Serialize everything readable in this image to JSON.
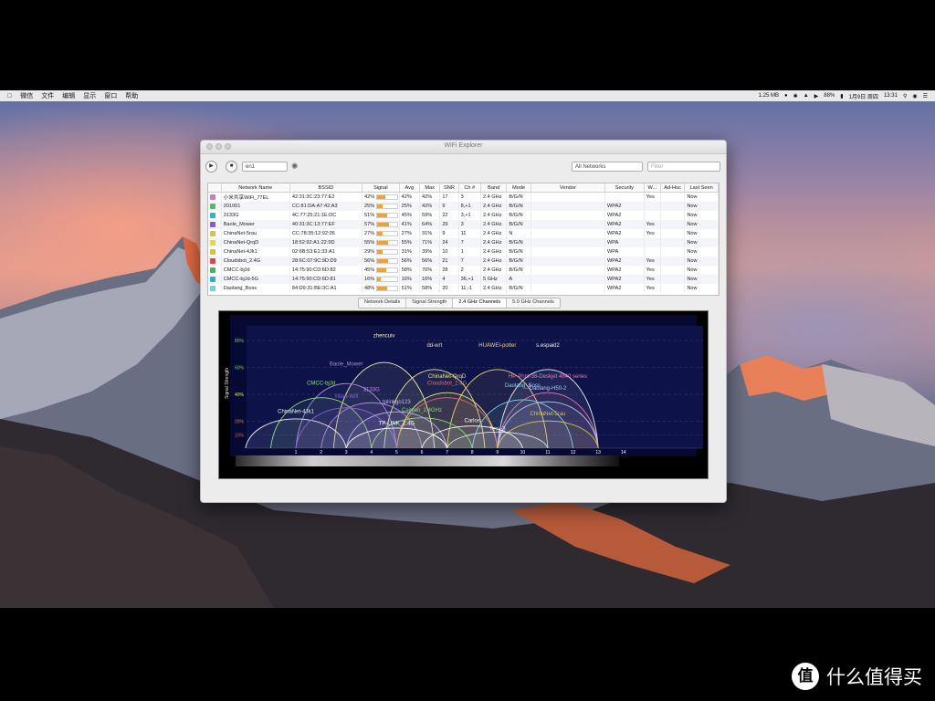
{
  "menubar": {
    "items": [
      "",
      "微信",
      "文件",
      "编辑",
      "显示",
      "窗口",
      "帮助"
    ],
    "right": {
      "net_speed": "1.25 MB",
      "battery": "88%",
      "date": "1月9日 周四",
      "time": "13:31"
    }
  },
  "window": {
    "title": "WiFi Explorer",
    "toolbar": {
      "scan_select": "en1",
      "filter_select": "All Networks",
      "search_placeholder": "Filter"
    },
    "columns": [
      "",
      "Network Name",
      "BSSID",
      "Signal",
      "Avg",
      "Max",
      "SNR",
      "Ch #",
      "Band",
      "Mode",
      "Vendor",
      "Security",
      "W...",
      "Ad-Hoc",
      "Last Seen"
    ],
    "rows": [
      {
        "check": "#c77dbe",
        "name": "小米共享WiFi_77EL",
        "bssid": "42:31:3C:23:77:E2",
        "signal": "42%",
        "sig": 42,
        "avg": "42%",
        "max": "42%",
        "snr": "17",
        "ch": "3",
        "band": "2.4 GHz",
        "mode": "B/G/N",
        "vendor": "",
        "security": "",
        "w": "Yes",
        "adhoc": "",
        "last": "Now"
      },
      {
        "check": "#58b86c",
        "name": "201001",
        "bssid": "CC:81:DA:A7:42:A3",
        "signal": "25%",
        "sig": 25,
        "avg": "25%",
        "max": "42%",
        "snr": "9",
        "ch": "8,+1",
        "band": "2.4 GHz",
        "mode": "B/G/N",
        "vendor": "",
        "security": "WPA2",
        "w": "",
        "adhoc": "",
        "last": "Now"
      },
      {
        "check": "#39b0d0",
        "name": "3133G",
        "bssid": "4C:77:25:21:1E:DC",
        "signal": "51%",
        "sig": 51,
        "avg": "45%",
        "max": "59%",
        "snr": "22",
        "ch": "3,+1",
        "band": "2.4 GHz",
        "mode": "B/G/N",
        "vendor": "",
        "security": "WPA2",
        "w": "",
        "adhoc": "",
        "last": "Now"
      },
      {
        "check": "#8a5cc2",
        "name": "Baole_Mower",
        "bssid": "40:31:3C:13:77:EF",
        "signal": "57%",
        "sig": 57,
        "avg": "41%",
        "max": "64%",
        "snr": "29",
        "ch": "3",
        "band": "2.4 GHz",
        "mode": "B/G/N",
        "vendor": "",
        "security": "WPA2",
        "w": "Yes",
        "adhoc": "",
        "last": "Now"
      },
      {
        "check": "#d4c24a",
        "name": "ChinaNet-5rau",
        "bssid": "CC:78:35:12:92:05",
        "signal": "27%",
        "sig": 27,
        "avg": "27%",
        "max": "31%",
        "snr": "9",
        "ch": "11",
        "band": "2.4 GHz",
        "mode": "N",
        "vendor": "",
        "security": "WPA2",
        "w": "Yes",
        "adhoc": "",
        "last": "Now"
      },
      {
        "check": "#e4d650",
        "name": "ChinaNet-QrqD",
        "bssid": "18:52:92:A1:22:9D",
        "signal": "55%",
        "sig": 55,
        "avg": "55%",
        "max": "71%",
        "snr": "24",
        "ch": "7",
        "band": "2.4 GHz",
        "mode": "B/G/N",
        "vendor": "",
        "security": "WPA",
        "w": "",
        "adhoc": "",
        "last": "Now"
      },
      {
        "check": "#d4c24a",
        "name": "ChinaNet-4Jk1",
        "bssid": "02:6B:53:E1:33:A1",
        "signal": "29%",
        "sig": 29,
        "avg": "31%",
        "max": "39%",
        "snr": "10",
        "ch": "1",
        "band": "2.4 GHz",
        "mode": "B/G/N",
        "vendor": "",
        "security": "WPA",
        "w": "",
        "adhoc": "",
        "last": "Now"
      },
      {
        "check": "#d64a4a",
        "name": "Cloudsbot_2.4G",
        "bssid": "28:6C:07:9C:9D:D9",
        "signal": "56%",
        "sig": 56,
        "avg": "56%",
        "max": "56%",
        "snr": "21",
        "ch": "7",
        "band": "2.4 GHz",
        "mode": "B/G/N",
        "vendor": "",
        "security": "WPA2",
        "w": "Yes",
        "adhoc": "",
        "last": "Now"
      },
      {
        "check": "#48b55e",
        "name": "CMCC-bjJd",
        "bssid": "14:75:90:CD:6D:82",
        "signal": "45%",
        "sig": 45,
        "avg": "58%",
        "max": "70%",
        "snr": "28",
        "ch": "2",
        "band": "2.4 GHz",
        "mode": "B/G/N",
        "vendor": "",
        "security": "WPA2",
        "w": "Yes",
        "adhoc": "",
        "last": "Now"
      },
      {
        "check": "#3ea6d4",
        "name": "CMCC-bjJd-5G",
        "bssid": "14:75:90:CD:6D:81",
        "signal": "16%",
        "sig": 16,
        "avg": "16%",
        "max": "16%",
        "snr": "4",
        "ch": "36,+1",
        "band": "5 GHz",
        "mode": "A",
        "vendor": "",
        "security": "WPA2",
        "w": "Yes",
        "adhoc": "",
        "last": "Now"
      },
      {
        "check": "#6fd3e0",
        "name": "Daolang_Boss",
        "bssid": "84:D9:31:BE:3C:A1",
        "signal": "48%",
        "sig": 48,
        "avg": "51%",
        "max": "58%",
        "snr": "20",
        "ch": "11,-1",
        "band": "2.4 GHz",
        "mode": "B/G/N",
        "vendor": "",
        "security": "WPA2",
        "w": "Yes",
        "adhoc": "",
        "last": "Now"
      }
    ],
    "tabs": [
      "Network Details",
      "Signal Strength",
      "2.4 GHz Channels",
      "5.0 GHz Channels"
    ],
    "active_tab": "2.4 GHz Channels"
  },
  "chart_data": {
    "type": "area",
    "ylabel": "Signal Strength",
    "yticks": [
      "80%",
      "60%",
      "40%",
      "20%",
      "10%"
    ],
    "x": [
      "1",
      "2",
      "3",
      "4",
      "5",
      "6",
      "7",
      "8",
      "9",
      "10",
      "11",
      "12",
      "13",
      "14"
    ],
    "series": [
      {
        "name": "zhencuiv",
        "center": 4.5,
        "width": 4,
        "strength": 85,
        "color": "#f2f2a6"
      },
      {
        "name": "dd-wrt",
        "center": 6.5,
        "width": 4,
        "strength": 78,
        "color": "#e9e398"
      },
      {
        "name": "HUAWEI-potter",
        "center": 9,
        "width": 4,
        "strength": 78,
        "color": "#f3d96a"
      },
      {
        "name": "s.espaid2",
        "center": 11,
        "width": 4,
        "strength": 78,
        "color": "#f1f1f1"
      },
      {
        "name": "Baole_Mower",
        "center": 3,
        "width": 4,
        "strength": 64,
        "color": "#a78ad6"
      },
      {
        "name": "CMCC-bjJd",
        "center": 2,
        "width": 4,
        "strength": 50,
        "color": "#8ee07a"
      },
      {
        "name": "3133G",
        "center": 4,
        "width": 4,
        "strength": 45,
        "color": "#b28ae8"
      },
      {
        "name": "ChinaNet-QrqD",
        "center": 7,
        "width": 4,
        "strength": 55,
        "color": "#f3e36a"
      },
      {
        "name": "Cloudsbot_2.4G",
        "center": 7,
        "width": 4,
        "strength": 50,
        "color": "#e56c6c"
      },
      {
        "name": "HP-Print-38-Deskjet 4640 series",
        "center": 11,
        "width": 4,
        "strength": 55,
        "color": "#e57ab8"
      },
      {
        "name": "Daolang_Boss",
        "center": 10,
        "width": 4,
        "strength": 48,
        "color": "#7fd4f0"
      },
      {
        "name": "Daolang-H50-2",
        "center": 11,
        "width": 4,
        "strength": 46,
        "color": "#b9c5f6"
      },
      {
        "name": "ChinaNet-4Jk1",
        "center": 1,
        "width": 4,
        "strength": 29,
        "color": "#f0f0f0"
      },
      {
        "name": "Yilian-Wifi",
        "center": 3,
        "width": 4,
        "strength": 40,
        "color": "#8a64d8"
      },
      {
        "name": "ChinaNet-5rau",
        "center": 11,
        "width": 4,
        "strength": 27,
        "color": "#d8c448"
      },
      {
        "name": "Tesy-3",
        "center": 9,
        "width": 4,
        "strength": 16,
        "color": "#e0e0e0"
      },
      {
        "name": "Cainiao_2.4GHz",
        "center": 6,
        "width": 4,
        "strength": 30,
        "color": "#7ee07a"
      },
      {
        "name": "tplinkgo123",
        "center": 5,
        "width": 4,
        "strength": 36,
        "color": "#c9b4f4"
      },
      {
        "name": "Carlos",
        "center": 8,
        "width": 4,
        "strength": 22,
        "color": "#ffffff"
      },
      {
        "name": "TP-LINK_2.4G",
        "center": 5,
        "width": 4,
        "strength": 20,
        "color": "#ffffff"
      }
    ]
  },
  "watermark": {
    "badge": "值",
    "text": "什么值得买"
  }
}
